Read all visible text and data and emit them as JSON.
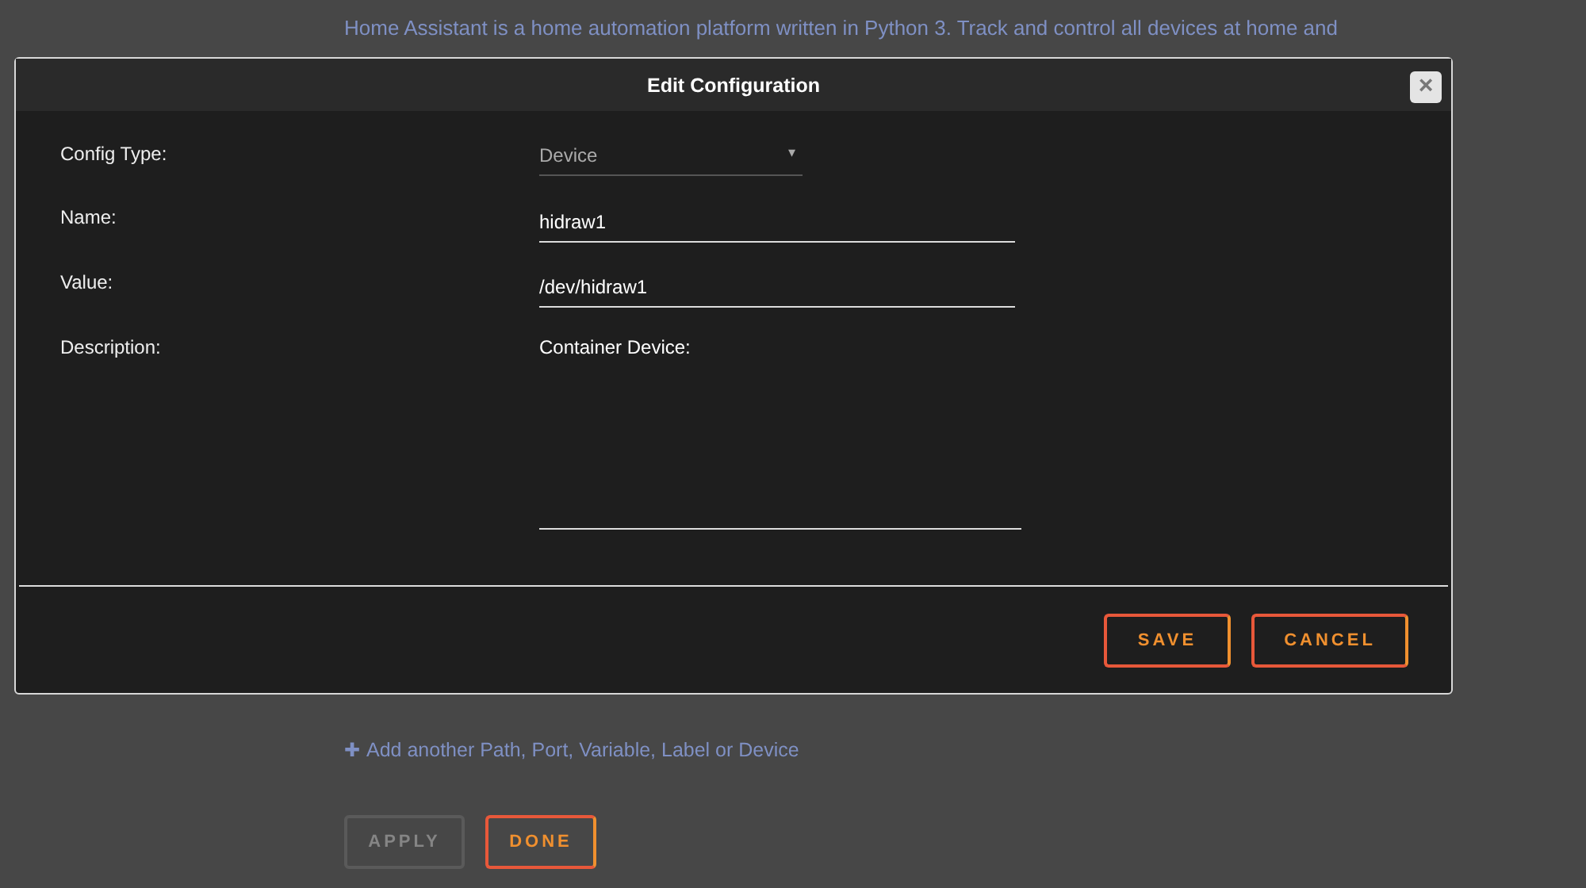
{
  "background": {
    "description": "Home Assistant is a home automation platform written in Python 3. Track and control all devices at home and",
    "add_link": {
      "icon": "✚",
      "label": "Add another Path, Port, Variable, Label or Device"
    },
    "buttons": [
      {
        "label": "APPLY",
        "disabled": true
      },
      {
        "label": "DONE",
        "disabled": false
      }
    ]
  },
  "dialog": {
    "title": "Edit Configuration",
    "close": "×",
    "fields": [
      {
        "kind": "select",
        "label": "Config Type:",
        "value": "Device",
        "caret": "▾"
      },
      {
        "kind": "text",
        "label": "Name:",
        "value": "hidraw1"
      },
      {
        "kind": "text",
        "label": "Value:",
        "value": "/dev/hidraw1"
      },
      {
        "kind": "textarea",
        "label": "Description:",
        "value": "Container Device:"
      }
    ],
    "buttons": [
      "SAVE",
      "CANCEL"
    ]
  }
}
